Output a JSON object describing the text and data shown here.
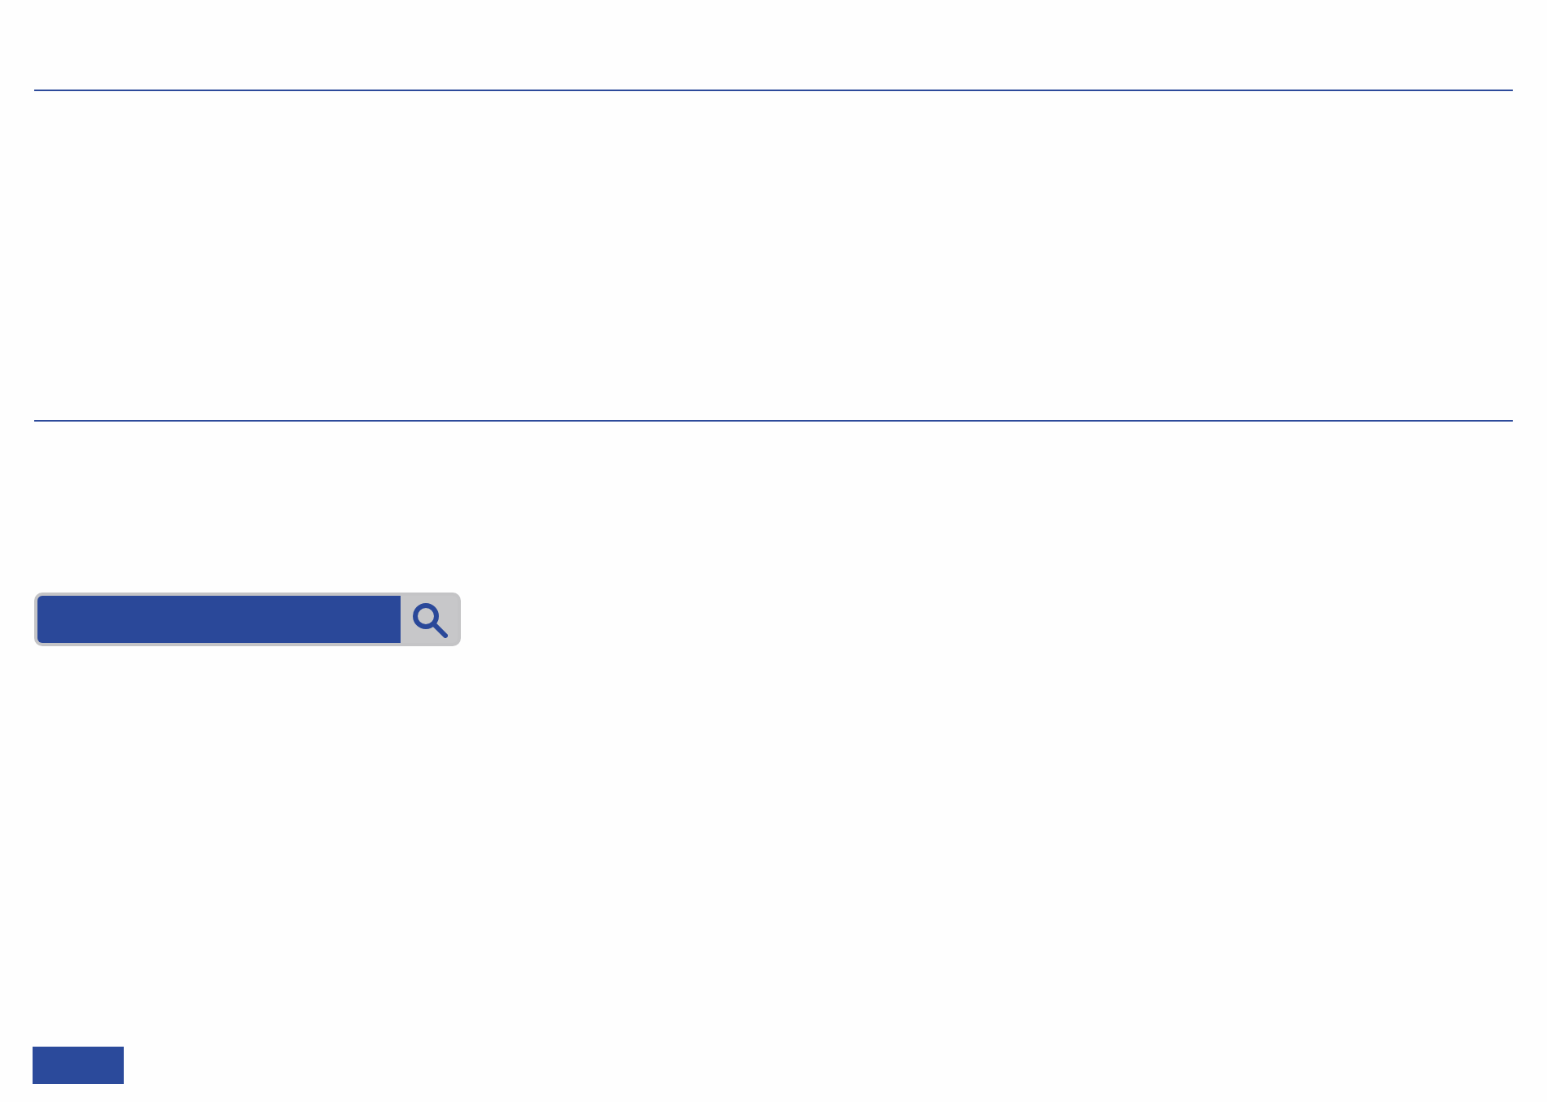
{
  "sections": [
    {
      "kind": "rule"
    },
    {
      "kind": "rule"
    },
    {
      "kind": "search"
    },
    {
      "kind": "button"
    }
  ]
}
